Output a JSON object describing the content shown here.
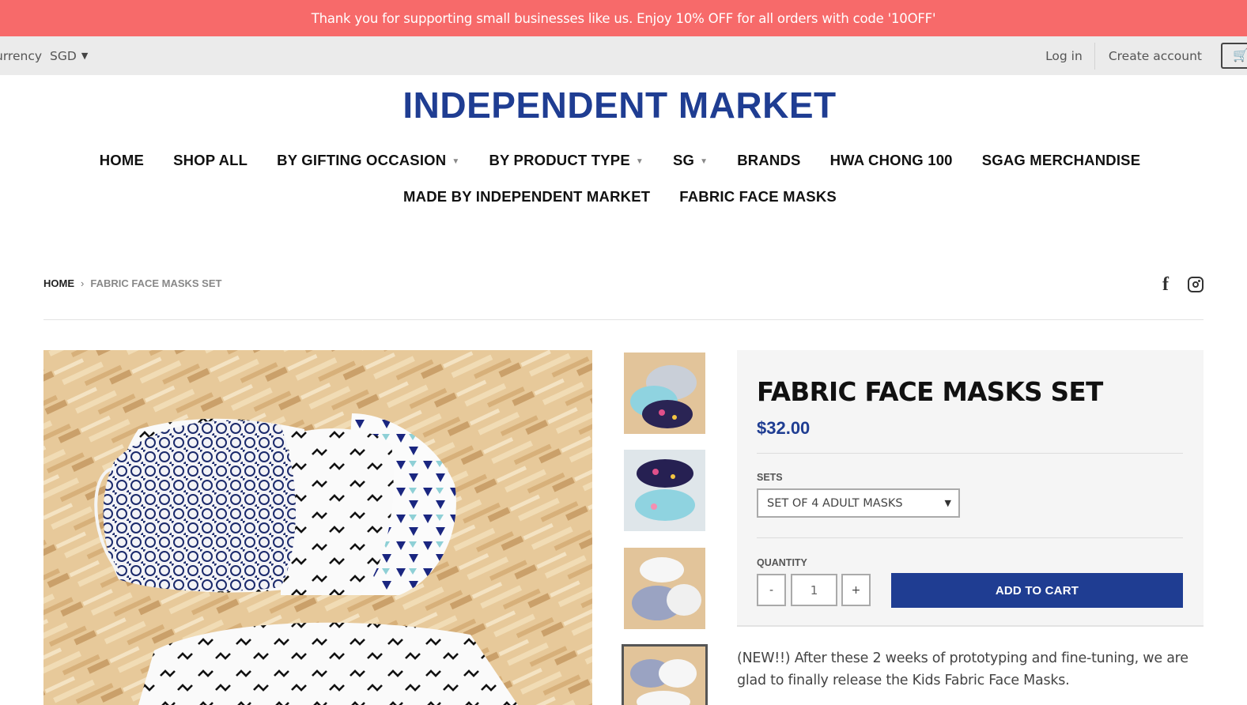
{
  "announcement": "Thank you for supporting small businesses like us. Enjoy 10% OFF for all orders with code '10OFF'",
  "utility": {
    "currency_label": "urrency",
    "currency_code": "SGD",
    "login": "Log in",
    "create_account": "Create account",
    "cart_icon": "cart-icon"
  },
  "logo": "INDEPENDENT MARKET",
  "nav": {
    "row1": [
      {
        "label": "HOME",
        "dropdown": false
      },
      {
        "label": "SHOP ALL",
        "dropdown": false
      },
      {
        "label": "BY GIFTING OCCASION",
        "dropdown": true
      },
      {
        "label": "BY PRODUCT TYPE",
        "dropdown": true
      },
      {
        "label": "SG",
        "dropdown": true
      },
      {
        "label": "BRANDS",
        "dropdown": false
      },
      {
        "label": "HWA CHONG 100",
        "dropdown": false
      },
      {
        "label": "SGAG MERCHANDISE",
        "dropdown": false
      }
    ],
    "row2": [
      {
        "label": "MADE BY INDEPENDENT MARKET",
        "dropdown": false
      },
      {
        "label": "FABRIC FACE MASKS",
        "dropdown": false
      }
    ]
  },
  "breadcrumb": {
    "home": "HOME",
    "separator": "›",
    "current": "FABRIC FACE MASKS SET"
  },
  "social": {
    "facebook": "f",
    "instagram_icon": "instagram-icon"
  },
  "product": {
    "title": "FABRIC FACE MASKS SET",
    "price": "$32.00",
    "sets_label": "SETS",
    "sets_value": "SET OF 4 ADULT MASKS",
    "quantity_label": "QUANTITY",
    "quantity_value": "1",
    "minus": "-",
    "plus": "+",
    "add_to_cart": "ADD TO CART",
    "description": "(NEW!!) After these 2 weeks of prototyping and fine-tuning, we are glad to finally release the Kids Fabric Face Masks."
  },
  "colors": {
    "announcement_bg": "#f76a6a",
    "brand_blue": "#1f3d92",
    "utility_bg": "#ebebeb",
    "panel_bg": "#f5f5f5"
  }
}
